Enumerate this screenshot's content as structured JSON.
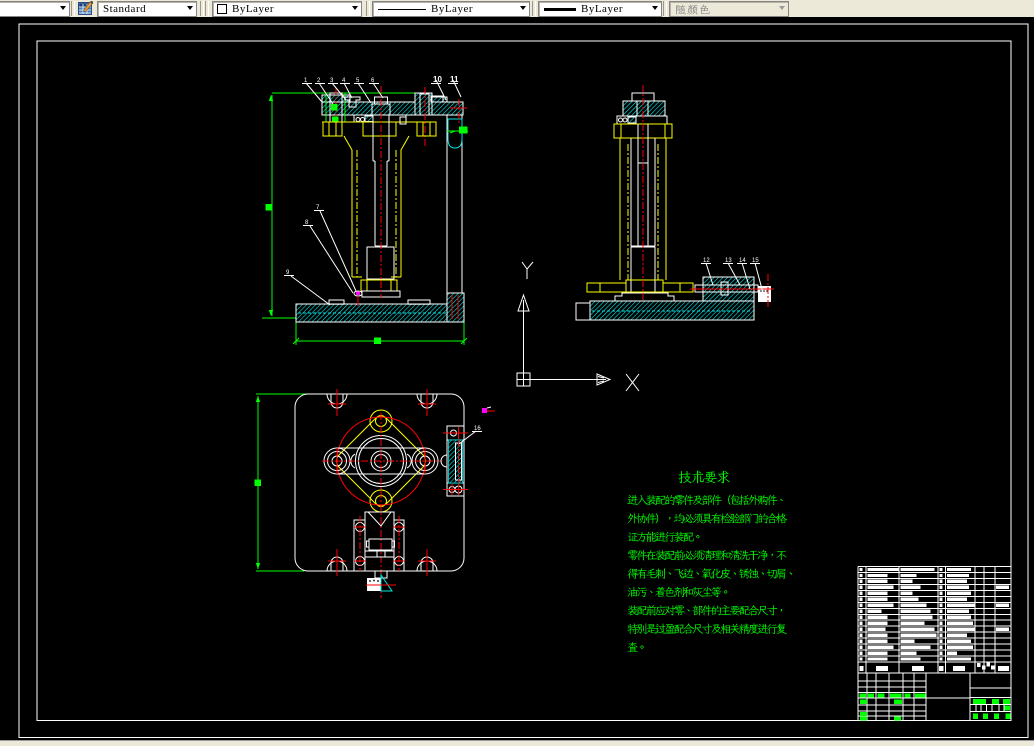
{
  "toolbar": {
    "layer_combo": {
      "value": ""
    },
    "text_style_combo": {
      "value": "Standard"
    },
    "color_combo": {
      "value": "ByLayer",
      "swatch_color": "#ffffff"
    },
    "linetype_combo": {
      "value": "ByLayer"
    },
    "lineweight_combo": {
      "value": "ByLayer"
    },
    "plot_style_combo": {
      "value": "随颜色",
      "disabled": true
    }
  },
  "ucs": {
    "x_label": "X",
    "y_label": "Y"
  },
  "tech_requirements": {
    "title": "技术要求",
    "lines": [
      "进入装配的零件及部件（包括外购件、",
      "外协件），均必须具有检验部门的合格",
      "证方能进行装配。",
      "零件在装配前必须清理和清洗干净，不",
      "得有毛刺、飞边、氧化皮、锈蚀、切屑、",
      "油污、着色剂和灰尘等。",
      "装配前应对零、部件的主要配合尺寸，",
      "特别是过盈配合尺寸及相关精度进行复",
      "查。"
    ]
  },
  "balloons": {
    "front_top": [
      "1",
      "2",
      "3",
      "4",
      "5",
      "6",
      "10",
      "11"
    ],
    "front_left": [
      "7",
      "8",
      "9"
    ],
    "side_right": [
      "12",
      "13",
      "14",
      "15"
    ],
    "plan_right": [
      "16"
    ]
  },
  "parts_list": {
    "bar_rows": [
      {
        "c2": 31,
        "c3": 34,
        "c5": 24,
        "c8": 0
      },
      {
        "c2": 20,
        "c3": 16,
        "c5": 22,
        "c8": 0
      },
      {
        "c2": 20,
        "c3": 12,
        "c5": 20,
        "c8": 0
      },
      {
        "c2": 26,
        "c3": 20,
        "c5": 22,
        "c8": 13
      },
      {
        "c2": 20,
        "c3": 12,
        "c5": 24,
        "c8": 0
      },
      {
        "c2": 20,
        "c3": 18,
        "c5": 20,
        "c8": 0
      },
      {
        "c2": 26,
        "c3": 26,
        "c5": 28,
        "c8": 13
      },
      {
        "c2": 14,
        "c3": 30,
        "c5": 22,
        "c8": 0
      },
      {
        "c2": 20,
        "c3": 32,
        "c5": 24,
        "c8": 0
      },
      {
        "c2": 20,
        "c3": 24,
        "c5": 26,
        "c8": 0
      },
      {
        "c2": 18,
        "c3": 34,
        "c5": 28,
        "c8": 13
      },
      {
        "c2": 20,
        "c3": 36,
        "c5": 20,
        "c8": 0
      },
      {
        "c2": 20,
        "c3": 14,
        "c5": 24,
        "c8": 0
      },
      {
        "c2": 26,
        "c3": 30,
        "c5": 26,
        "c8": 0
      },
      {
        "c2": 20,
        "c3": 16,
        "c5": 10,
        "c8": 0
      },
      {
        "c2": 20,
        "c3": 20,
        "c5": 24,
        "c8": 0
      }
    ]
  },
  "colors": {
    "canvas": "#000000",
    "outline": "#ffffff",
    "hatch": "#00ffff",
    "centerline": "#ff0000",
    "dimension": "#00ff00",
    "auxiliary": "#ffff00",
    "accent": "#ff00ff"
  }
}
